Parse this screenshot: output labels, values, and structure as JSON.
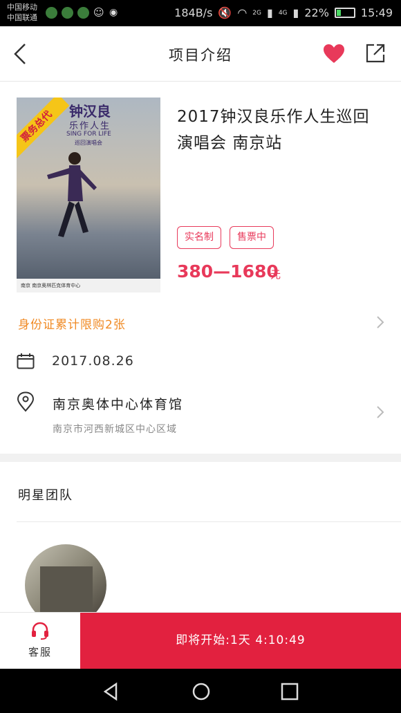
{
  "status_bar": {
    "carrier1": "中国移动",
    "carrier2": "中国联通",
    "speed": "184B/s",
    "network_2g": "2G",
    "network_4g": "4G",
    "battery": "22%",
    "battery_level": 0.22,
    "time": "15:49"
  },
  "header": {
    "title": "项目介绍",
    "favorite_active": true,
    "accent_color": "#e8395a"
  },
  "poster": {
    "ribbon": "票务总代",
    "artist": "钟汉良",
    "subtitle": "乐作人生",
    "english": "SING FOR LIFE",
    "tour": "巡回演唱会",
    "footer": "南京 南京奥林匹克体育中心"
  },
  "event": {
    "title": "2017钟汉良乐作人生巡回演唱会 南京站",
    "tags": [
      "实名制",
      "售票中"
    ],
    "price": "380—1680",
    "price_unit": "元"
  },
  "limit": {
    "text": "身份证累计限购2张"
  },
  "schedule": {
    "date": "2017.08.26"
  },
  "venue": {
    "name": "南京奥体中心体育馆",
    "address": "南京市河西新城区中心区域"
  },
  "team": {
    "header": "明星团队"
  },
  "bottom_bar": {
    "service_label": "客服",
    "buy_label": "即将开始:1天 4:10:49",
    "buy_color": "#e2213f"
  }
}
